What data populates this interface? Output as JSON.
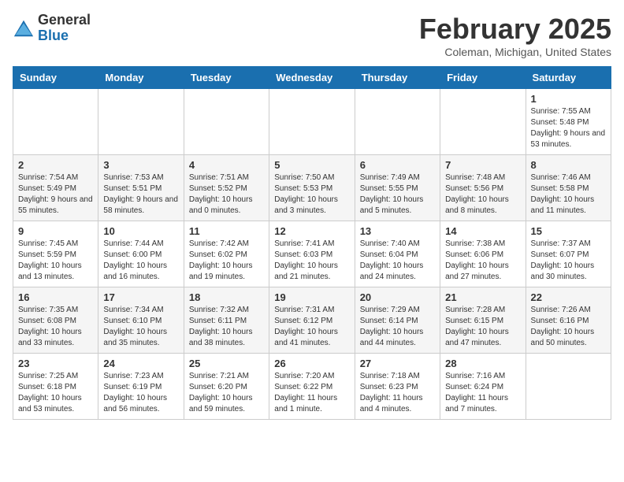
{
  "logo": {
    "general": "General",
    "blue": "Blue"
  },
  "header": {
    "month": "February 2025",
    "location": "Coleman, Michigan, United States"
  },
  "days_of_week": [
    "Sunday",
    "Monday",
    "Tuesday",
    "Wednesday",
    "Thursday",
    "Friday",
    "Saturday"
  ],
  "weeks": [
    [
      {
        "day": "",
        "info": ""
      },
      {
        "day": "",
        "info": ""
      },
      {
        "day": "",
        "info": ""
      },
      {
        "day": "",
        "info": ""
      },
      {
        "day": "",
        "info": ""
      },
      {
        "day": "",
        "info": ""
      },
      {
        "day": "1",
        "info": "Sunrise: 7:55 AM\nSunset: 5:48 PM\nDaylight: 9 hours and 53 minutes."
      }
    ],
    [
      {
        "day": "2",
        "info": "Sunrise: 7:54 AM\nSunset: 5:49 PM\nDaylight: 9 hours and 55 minutes."
      },
      {
        "day": "3",
        "info": "Sunrise: 7:53 AM\nSunset: 5:51 PM\nDaylight: 9 hours and 58 minutes."
      },
      {
        "day": "4",
        "info": "Sunrise: 7:51 AM\nSunset: 5:52 PM\nDaylight: 10 hours and 0 minutes."
      },
      {
        "day": "5",
        "info": "Sunrise: 7:50 AM\nSunset: 5:53 PM\nDaylight: 10 hours and 3 minutes."
      },
      {
        "day": "6",
        "info": "Sunrise: 7:49 AM\nSunset: 5:55 PM\nDaylight: 10 hours and 5 minutes."
      },
      {
        "day": "7",
        "info": "Sunrise: 7:48 AM\nSunset: 5:56 PM\nDaylight: 10 hours and 8 minutes."
      },
      {
        "day": "8",
        "info": "Sunrise: 7:46 AM\nSunset: 5:58 PM\nDaylight: 10 hours and 11 minutes."
      }
    ],
    [
      {
        "day": "9",
        "info": "Sunrise: 7:45 AM\nSunset: 5:59 PM\nDaylight: 10 hours and 13 minutes."
      },
      {
        "day": "10",
        "info": "Sunrise: 7:44 AM\nSunset: 6:00 PM\nDaylight: 10 hours and 16 minutes."
      },
      {
        "day": "11",
        "info": "Sunrise: 7:42 AM\nSunset: 6:02 PM\nDaylight: 10 hours and 19 minutes."
      },
      {
        "day": "12",
        "info": "Sunrise: 7:41 AM\nSunset: 6:03 PM\nDaylight: 10 hours and 21 minutes."
      },
      {
        "day": "13",
        "info": "Sunrise: 7:40 AM\nSunset: 6:04 PM\nDaylight: 10 hours and 24 minutes."
      },
      {
        "day": "14",
        "info": "Sunrise: 7:38 AM\nSunset: 6:06 PM\nDaylight: 10 hours and 27 minutes."
      },
      {
        "day": "15",
        "info": "Sunrise: 7:37 AM\nSunset: 6:07 PM\nDaylight: 10 hours and 30 minutes."
      }
    ],
    [
      {
        "day": "16",
        "info": "Sunrise: 7:35 AM\nSunset: 6:08 PM\nDaylight: 10 hours and 33 minutes."
      },
      {
        "day": "17",
        "info": "Sunrise: 7:34 AM\nSunset: 6:10 PM\nDaylight: 10 hours and 35 minutes."
      },
      {
        "day": "18",
        "info": "Sunrise: 7:32 AM\nSunset: 6:11 PM\nDaylight: 10 hours and 38 minutes."
      },
      {
        "day": "19",
        "info": "Sunrise: 7:31 AM\nSunset: 6:12 PM\nDaylight: 10 hours and 41 minutes."
      },
      {
        "day": "20",
        "info": "Sunrise: 7:29 AM\nSunset: 6:14 PM\nDaylight: 10 hours and 44 minutes."
      },
      {
        "day": "21",
        "info": "Sunrise: 7:28 AM\nSunset: 6:15 PM\nDaylight: 10 hours and 47 minutes."
      },
      {
        "day": "22",
        "info": "Sunrise: 7:26 AM\nSunset: 6:16 PM\nDaylight: 10 hours and 50 minutes."
      }
    ],
    [
      {
        "day": "23",
        "info": "Sunrise: 7:25 AM\nSunset: 6:18 PM\nDaylight: 10 hours and 53 minutes."
      },
      {
        "day": "24",
        "info": "Sunrise: 7:23 AM\nSunset: 6:19 PM\nDaylight: 10 hours and 56 minutes."
      },
      {
        "day": "25",
        "info": "Sunrise: 7:21 AM\nSunset: 6:20 PM\nDaylight: 10 hours and 59 minutes."
      },
      {
        "day": "26",
        "info": "Sunrise: 7:20 AM\nSunset: 6:22 PM\nDaylight: 11 hours and 1 minute."
      },
      {
        "day": "27",
        "info": "Sunrise: 7:18 AM\nSunset: 6:23 PM\nDaylight: 11 hours and 4 minutes."
      },
      {
        "day": "28",
        "info": "Sunrise: 7:16 AM\nSunset: 6:24 PM\nDaylight: 11 hours and 7 minutes."
      },
      {
        "day": "",
        "info": ""
      }
    ]
  ]
}
